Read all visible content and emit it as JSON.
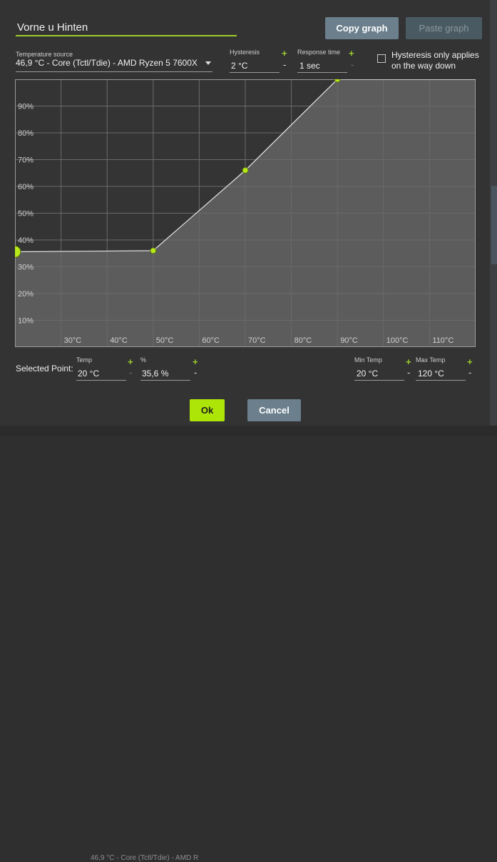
{
  "curve_name": "Vorne u Hinten",
  "buttons": {
    "copy_graph": "Copy graph",
    "paste_graph": "Paste graph",
    "ok": "Ok",
    "cancel": "Cancel"
  },
  "temperature_source": {
    "label": "Temperature source",
    "value": "46,9 °C - Core (Tctl/Tdie) - AMD Ryzen 5 7600X"
  },
  "hysteresis": {
    "label": "Hysteresis",
    "value": "2 °C"
  },
  "response_time": {
    "label": "Response time",
    "value": "1 sec"
  },
  "hysteresis_down": {
    "label_line1": "Hysteresis only applies",
    "label_line2": "on the way down",
    "checked": false
  },
  "selected_point": {
    "label": "Selected Point:",
    "temp_label": "Temp",
    "temp_value": "20 °C",
    "pct_label": "%",
    "pct_value": "35,6 %"
  },
  "min_temp": {
    "label": "Min Temp",
    "value": "20 °C"
  },
  "max_temp": {
    "label": "Max Temp",
    "value": "120 °C"
  },
  "symbols": {
    "plus": "+",
    "minus": "-"
  },
  "background_text": "46,9 °C - Core (Tctl/Tdie) - AMD R",
  "colors": {
    "accent": "#9acd2c",
    "ok_button": "#aee508",
    "secondary_button": "#6b7f8c",
    "graph_bg": "#343434",
    "fill": "#5c5c5c"
  },
  "chart_data": {
    "type": "line",
    "x_tick_labels": [
      "30°C",
      "40°C",
      "50°C",
      "60°C",
      "70°C",
      "80°C",
      "90°C",
      "100°C",
      "110°C"
    ],
    "y_tick_labels": [
      "10%",
      "20%",
      "30%",
      "40%",
      "50%",
      "60%",
      "70%",
      "80%",
      "90%"
    ],
    "xlim": [
      20,
      120
    ],
    "ylim": [
      0,
      100
    ],
    "points": [
      {
        "x": 20,
        "y": 35.6,
        "selected": true
      },
      {
        "x": 50,
        "y": 36
      },
      {
        "x": 70,
        "y": 66
      },
      {
        "x": 90,
        "y": 100
      }
    ],
    "grid": true,
    "area_fill": true
  }
}
